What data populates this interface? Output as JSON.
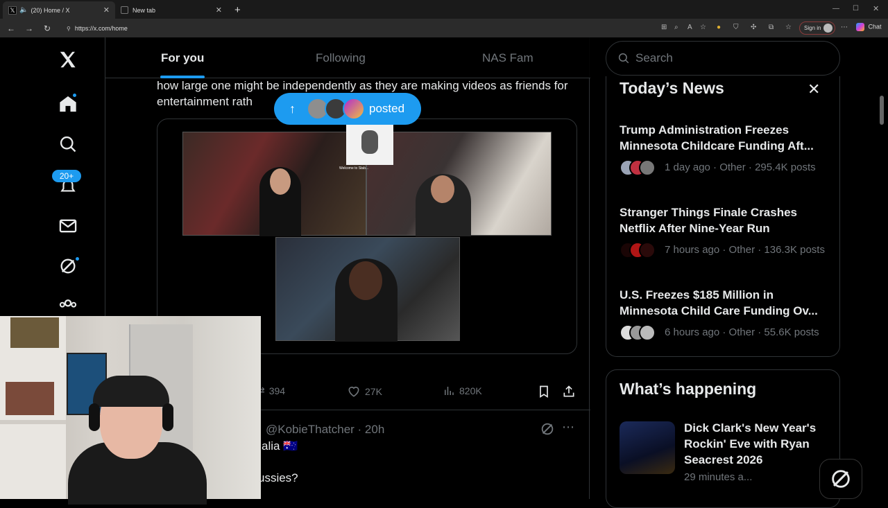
{
  "browser": {
    "tabs": [
      {
        "label": "(20) Home / X",
        "active": true
      },
      {
        "label": "New tab",
        "active": false
      }
    ],
    "new_tab": "+",
    "url": "https://x.com/home",
    "sign_in": "Sign in",
    "chat": "Chat"
  },
  "sidebar": {
    "notifications_badge": "20+"
  },
  "feed": {
    "tabs": [
      "For you",
      "Following",
      "NAS Fam"
    ],
    "tweet_text": "how large one might be independently as they are making videos as friends for entertainment rath",
    "posted_label": "posted",
    "overlay_text": "Welcome to Stab...",
    "actions": {
      "retweets": "394",
      "likes": "27K",
      "views": "820K"
    },
    "tweet2": {
      "handle": "@KobieThatcher · 20h",
      "line1": "alia 🇦🇺",
      "line2": "ussies?"
    }
  },
  "right": {
    "search_placeholder": "Search",
    "news_title": "Today’s News",
    "news": [
      {
        "headline": "Trump Administration Freezes Minnesota Childcare Funding Aft...",
        "meta": "1 day ago · Other · 295.4K posts"
      },
      {
        "headline": "Stranger Things Finale Crashes Netflix After Nine-Year Run",
        "meta": "7 hours ago · Other · 136.3K posts"
      },
      {
        "headline": "U.S. Freezes $185 Million in Minnesota Child Care Funding Ov...",
        "meta": "6 hours ago · Other · 55.6K posts"
      }
    ],
    "happening_title": "What’s happening",
    "happening": {
      "headline": "Dick Clark's New Year's Rockin' Eve with Ryan Seacrest 2026",
      "meta": "29 minutes a..."
    }
  }
}
